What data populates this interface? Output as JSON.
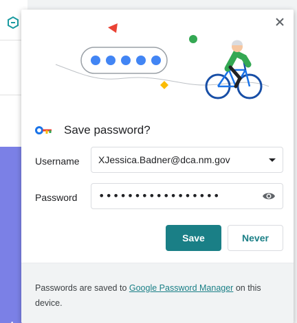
{
  "dialog": {
    "title": "Save password?",
    "username_label": "Username",
    "username_value": "XJessica.Badner@dca.nm.gov",
    "password_label": "Password",
    "password_mask": "•••••••••••••••••",
    "save_label": "Save",
    "never_label": "Never",
    "close_icon": "close-icon",
    "eye_icon": "eye-icon",
    "key_icon": "key-icon"
  },
  "footer": {
    "text_before": "Passwords are saved to ",
    "link_text": "Google Password Manager",
    "text_after": " on this device."
  },
  "background_page": {
    "partial_text": "te"
  },
  "colors": {
    "accent": "#1a7f86",
    "dots": "#4285f4",
    "triangle": "#ea4335",
    "green": "#34a853",
    "yellow": "#fbbc04",
    "background_band": "#7b80e6"
  }
}
